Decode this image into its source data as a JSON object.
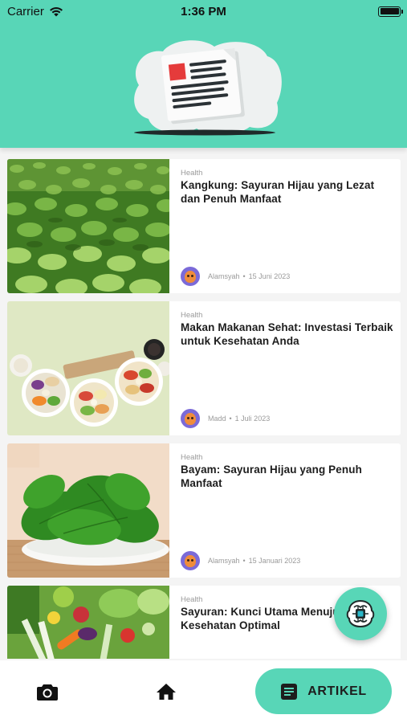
{
  "status_bar": {
    "carrier": "Carrier",
    "time": "1:36 PM"
  },
  "articles": [
    {
      "category": "Health",
      "title": "Kangkung: Sayuran Hijau yang Lezat dan Penuh Manfaat",
      "author": "Alamsyah",
      "date": "15 Juni 2023",
      "image": "kangkung-field-photo"
    },
    {
      "category": "Health",
      "title": "Makan Makanan Sehat: Investasi Terbaik untuk Kesehatan Anda",
      "author": "Madd",
      "date": "1 Juli 2023",
      "image": "salad-bowls-photo"
    },
    {
      "category": "Health",
      "title": "Bayam: Sayuran Hijau yang Penuh Manfaat",
      "author": "Alamsyah",
      "date": "15 Januari 2023",
      "image": "spinach-plate-photo"
    },
    {
      "category": "Health",
      "title": "Sayuran: Kunci Utama Menuju Kesehatan Optimal",
      "author": "",
      "date": "",
      "image": "mixed-vegetables-photo"
    }
  ],
  "meta_separator": "•",
  "fab": {
    "icon": "ai-chip-brain-icon"
  },
  "bottom_nav": {
    "camera_icon": "camera-icon",
    "home_icon": "home-icon",
    "article_icon": "article-icon",
    "article_label": "ARTIKEL"
  },
  "colors": {
    "accent": "#58d6b7",
    "background": "#f4f4f4",
    "card": "#ffffff",
    "title_text": "#1d1d1d",
    "muted_text": "#9a9a9a"
  }
}
